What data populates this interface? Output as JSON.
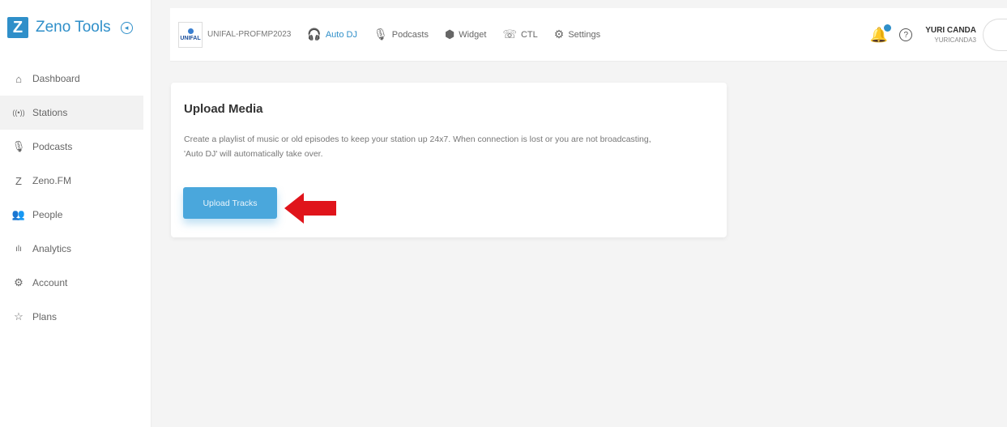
{
  "brand": {
    "logo_letter": "Z",
    "name": "Zeno Tools"
  },
  "sidebar": {
    "items": [
      {
        "label": "Dashboard",
        "icon": "⌂",
        "icon_name": "home-icon"
      },
      {
        "label": "Stations",
        "icon": "((•))",
        "icon_name": "broadcast-icon"
      },
      {
        "label": "Podcasts",
        "icon": "🎙",
        "icon_name": "microphone-icon"
      },
      {
        "label": "Zeno.FM",
        "icon": "Z",
        "icon_name": "zeno-fm-icon"
      },
      {
        "label": "People",
        "icon": "👥",
        "icon_name": "people-icon"
      },
      {
        "label": "Analytics",
        "icon": "ılı",
        "icon_name": "analytics-icon"
      },
      {
        "label": "Account",
        "icon": "⚙",
        "icon_name": "account-icon"
      },
      {
        "label": "Plans",
        "icon": "☆",
        "icon_name": "star-icon"
      }
    ]
  },
  "topbar": {
    "station_logo_text": "UNIFAL",
    "station_name": "UNIFAL-PROFMP2023",
    "links": [
      {
        "label": "Auto DJ",
        "icon": "🎧",
        "icon_name": "headphones-icon"
      },
      {
        "label": "Podcasts",
        "icon": "🎙",
        "icon_name": "microphone-icon"
      },
      {
        "label": "Widget",
        "icon": "⬢",
        "icon_name": "widget-icon"
      },
      {
        "label": "CTL",
        "icon": "☏",
        "icon_name": "phone-icon"
      },
      {
        "label": "Settings",
        "icon": "⚙",
        "icon_name": "gear-icon"
      }
    ],
    "help_icon": "?",
    "user_name": "YURI CANDA",
    "user_handle": "YURICANDA3"
  },
  "card": {
    "title": "Upload Media",
    "text": "Create a playlist of music or old episodes to keep your station up 24x7. When connection is lost or you are not broadcasting, 'Auto DJ' will automatically take over.",
    "button_label": "Upload Tracks"
  },
  "colors": {
    "accent": "#2f8fc9",
    "button": "#4aa7dc",
    "arrow": "#e0141b"
  }
}
